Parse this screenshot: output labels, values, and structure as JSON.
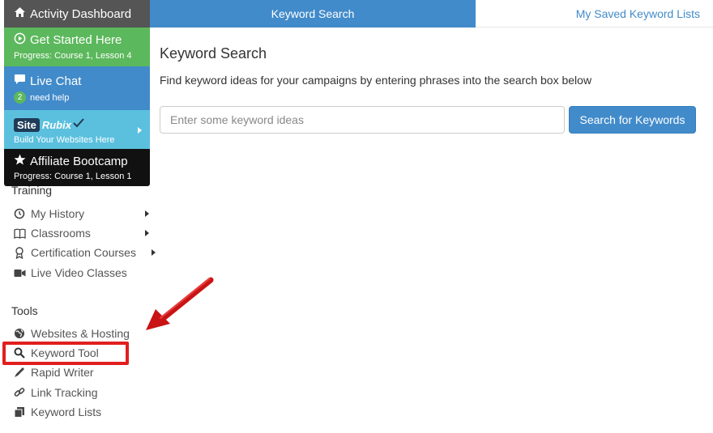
{
  "menu": {
    "dashboard": {
      "label": "Activity Dashboard",
      "icon": "home-icon"
    },
    "get_started": {
      "label": "Get Started Here",
      "progress": "Progress: Course 1, Lesson 4",
      "icon": "play-circle-icon"
    },
    "live_chat": {
      "label": "Live Chat",
      "count": "2",
      "sub": "need help",
      "icon": "chat-bubble-icon"
    },
    "siterubix": {
      "logo_site": "Site",
      "logo_rubix": "Rubix",
      "sub": "Build Your Websites Here"
    },
    "affiliate": {
      "label": "Affiliate Bootcamp",
      "progress": "Progress: Course 1, Lesson 1",
      "icon": "star-icon"
    }
  },
  "sidebar": {
    "training_title": "Training",
    "training_items": [
      {
        "label": "My History",
        "icon": "history-icon"
      },
      {
        "label": "Classrooms",
        "icon": "book-icon"
      },
      {
        "label": "Certification Courses",
        "icon": "certificate-icon"
      },
      {
        "label": "Live Video Classes",
        "icon": "video-camera-icon"
      }
    ],
    "tools_title": "Tools",
    "tools_items": [
      {
        "label": "Websites & Hosting",
        "icon": "globe-icon"
      },
      {
        "label": "Keyword Tool",
        "icon": "search-icon"
      },
      {
        "label": "Rapid Writer",
        "icon": "pen-icon"
      },
      {
        "label": "Link Tracking",
        "icon": "link-icon"
      },
      {
        "label": "Keyword Lists",
        "icon": "copy-icon"
      }
    ]
  },
  "tabs": {
    "active": "Keyword Search",
    "inactive": "My Saved Keyword Lists"
  },
  "main": {
    "title": "Keyword Search",
    "description": "Find keyword ideas for your campaigns by entering phrases into the search box below",
    "search_placeholder": "Enter some keyword ideas",
    "search_button": "Search for Keywords"
  },
  "colors": {
    "accent": "#428bca",
    "green": "#5cb85c",
    "cyan": "#5bc0de",
    "highlight": "#e21e1e"
  }
}
